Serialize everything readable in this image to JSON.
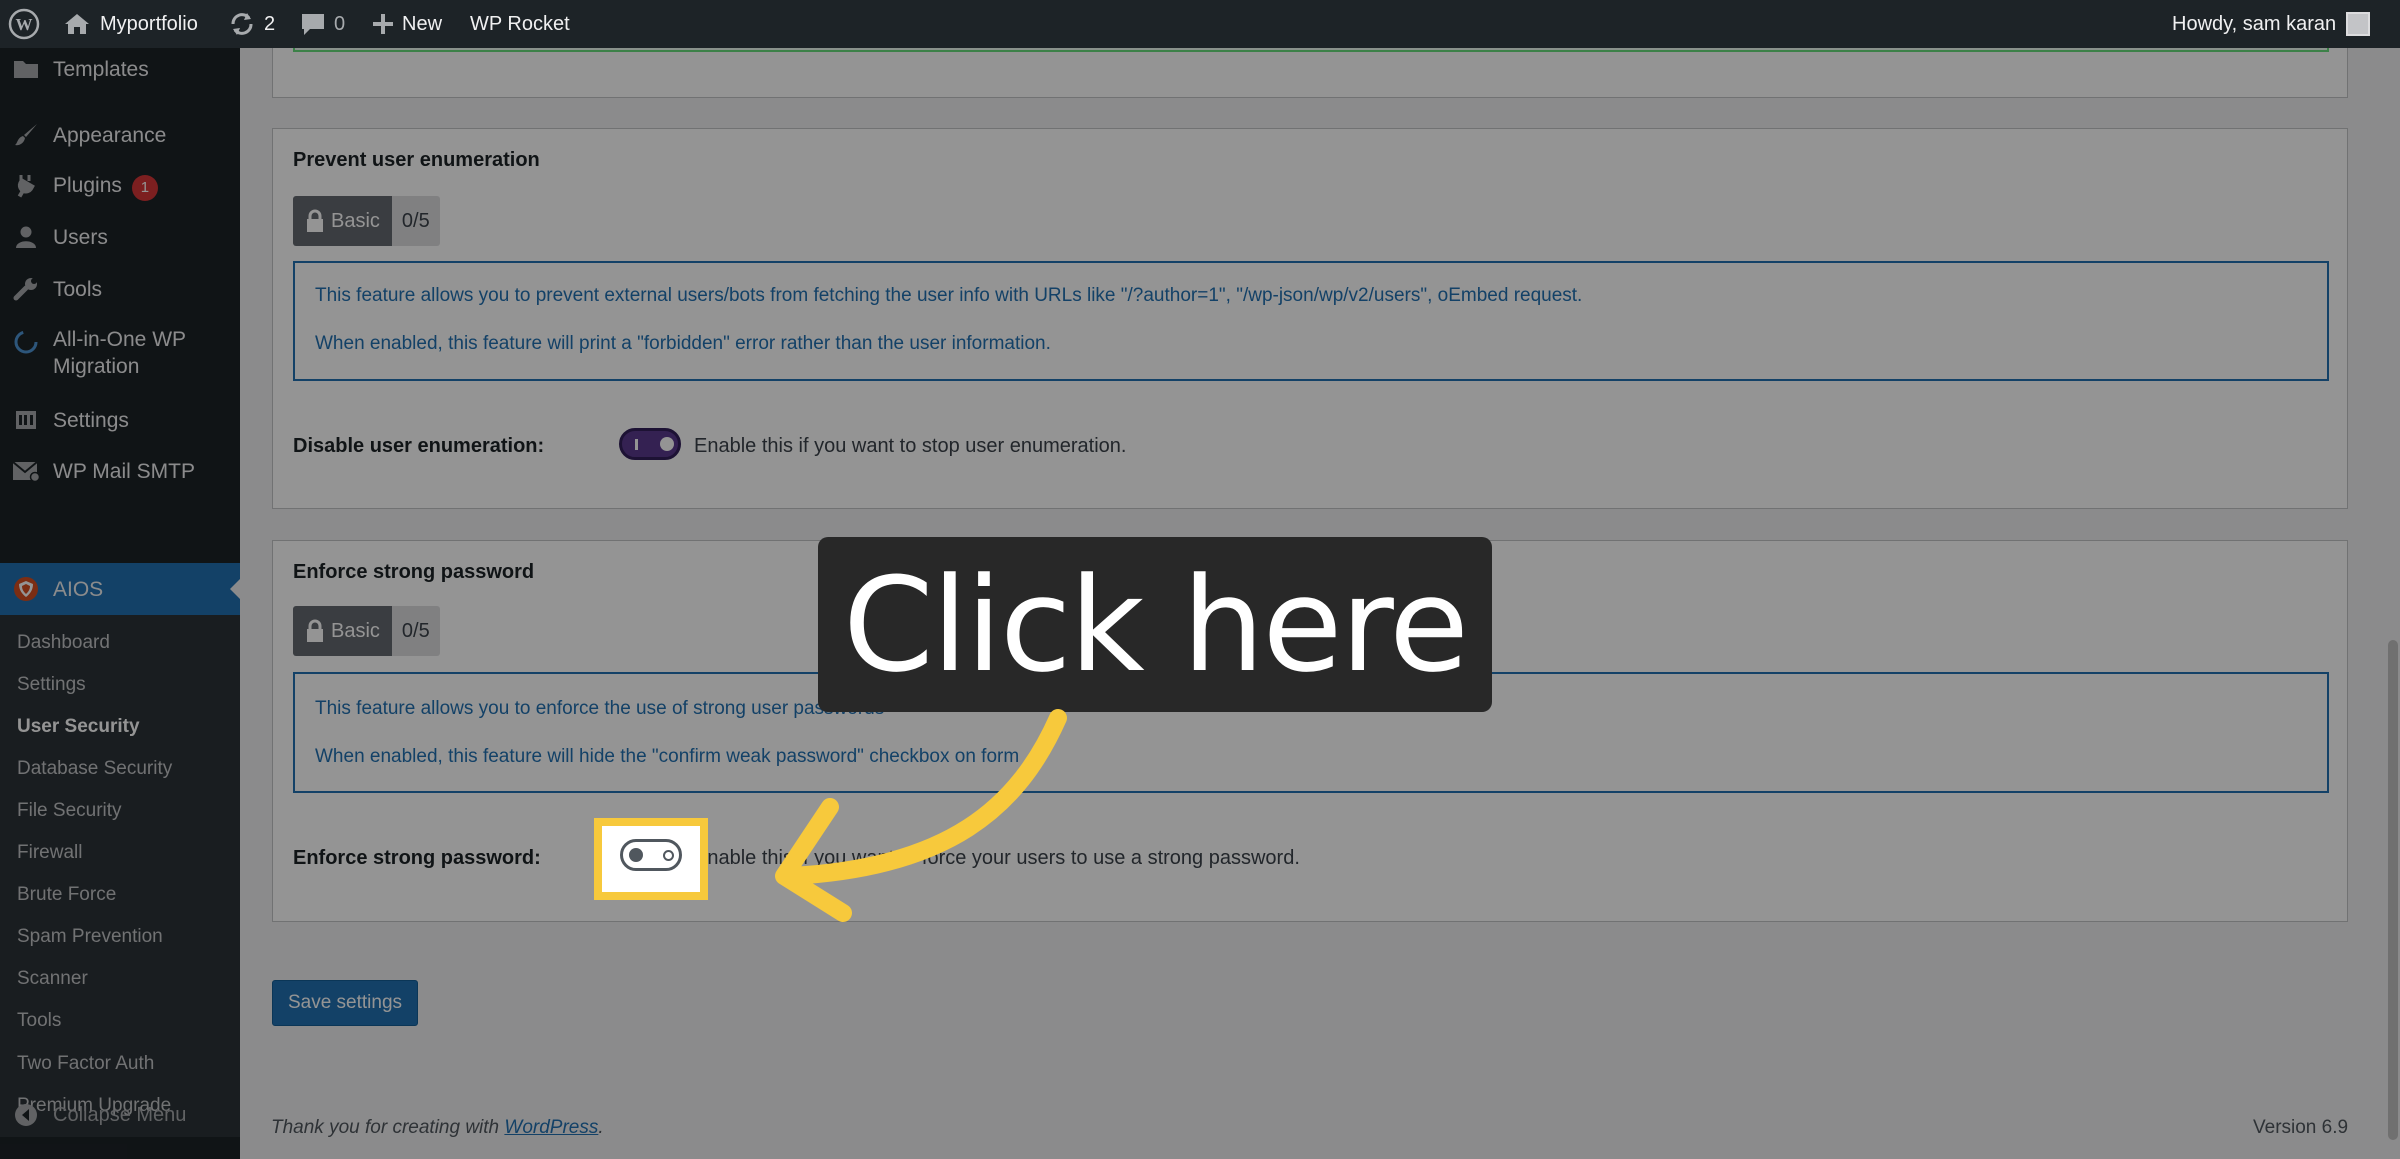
{
  "admin_bar": {
    "site_name": "Myportfolio",
    "updates_count": "2",
    "comments_count": "0",
    "new_label": "New",
    "wp_rocket_label": "WP Rocket",
    "howdy": "Howdy, sam karan"
  },
  "sidebar": {
    "items": [
      {
        "label": "Templates",
        "icon": "folder-icon"
      },
      {
        "label": "Appearance",
        "icon": "paintbrush-icon"
      },
      {
        "label": "Plugins",
        "icon": "plugin-icon",
        "badge": "1"
      },
      {
        "label": "Users",
        "icon": "users-icon"
      },
      {
        "label": "Tools",
        "icon": "wrench-icon"
      },
      {
        "label": "All-in-One WP",
        "label2": "Migration",
        "icon": "migration-icon"
      },
      {
        "label": "Settings",
        "icon": "settings-icon"
      },
      {
        "label": "WP Mail SMTP",
        "icon": "mail-icon"
      }
    ],
    "active": {
      "label": "AIOS",
      "icon": "aios-shield-icon"
    },
    "submenu": [
      "Dashboard",
      "Settings",
      "User Security",
      "Database Security",
      "File Security",
      "Firewall",
      "Brute Force",
      "Spam Prevention",
      "Scanner",
      "Tools",
      "Two Factor Auth",
      "Premium Upgrade"
    ],
    "current_submenu": "User Security",
    "collapse_label": "Collapse Menu"
  },
  "sections": {
    "enumeration": {
      "title": "Prevent user enumeration",
      "badge_label": "Basic",
      "score": "0/5",
      "info_line1": "This feature allows you to prevent external users/bots from fetching the user info with URLs like \"/?author=1\", \"/wp-json/wp/v2/users\", oEmbed request.",
      "info_line2": "When enabled, this feature will print a \"forbidden\" error rather than the user information.",
      "option_label": "Disable user enumeration:",
      "option_desc": "Enable this if you want to stop user enumeration.",
      "enabled": true
    },
    "password": {
      "title": "Enforce strong password",
      "badge_label": "Basic",
      "score": "0/5",
      "info_line1": "This feature allows you to enforce the use of strong user passwords",
      "info_line2": "When enabled, this feature will hide the \"confirm weak password\" checkbox on form",
      "option_label": "Enforce strong password:",
      "option_desc": "Enable this if you want to force your users to use a strong password.",
      "enabled": false
    }
  },
  "save_label": "Save settings",
  "footer": {
    "thanks_prefix": "Thank you for creating with ",
    "wordpress_link": "WordPress",
    "thanks_suffix": ".",
    "version": "Version 6.9"
  },
  "callout": {
    "text": "Click here",
    "highlight_color": "#f7c93c"
  },
  "colors": {
    "admin_bg": "#1d2327",
    "accent": "#2271b1",
    "toggle_on": "#5b3a8e",
    "badge_red": "#d63638"
  }
}
